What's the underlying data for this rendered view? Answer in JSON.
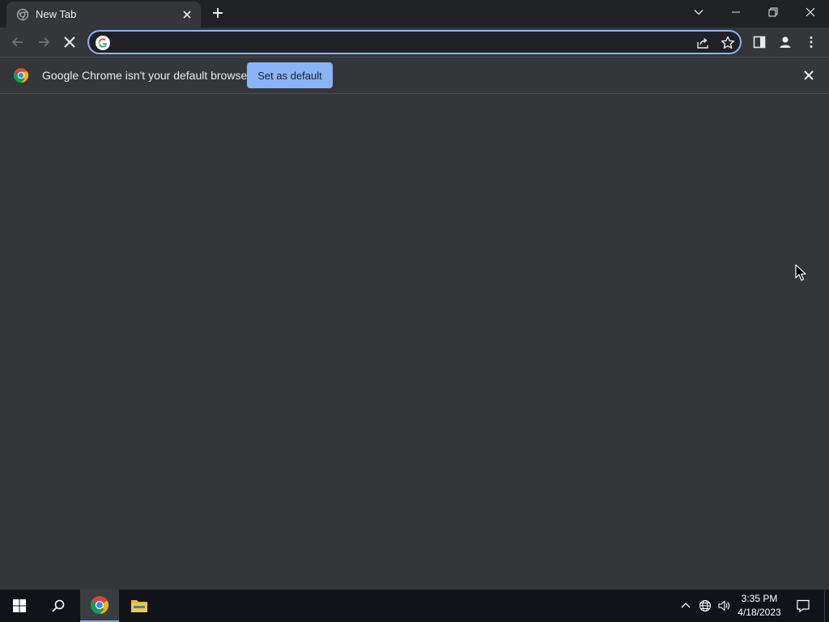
{
  "browser": {
    "tab": {
      "title": "New Tab",
      "favicon": "chrome-loading-icon"
    },
    "window_controls": [
      "tab-search-icon",
      "minimize-icon",
      "restore-icon",
      "close-icon"
    ],
    "omnibox": {
      "value": "",
      "placeholder": ""
    },
    "infobar": {
      "message": "Google Chrome isn't your default browser",
      "button_label": "Set as default"
    }
  },
  "taskbar": {
    "clock": {
      "time": "3:35 PM",
      "date": "4/18/2023"
    }
  },
  "colors": {
    "tabstrip_bg": "#202124",
    "toolbar_bg": "#35363a",
    "accent": "#8ab4f8",
    "taskbar_bg": "#101418"
  }
}
